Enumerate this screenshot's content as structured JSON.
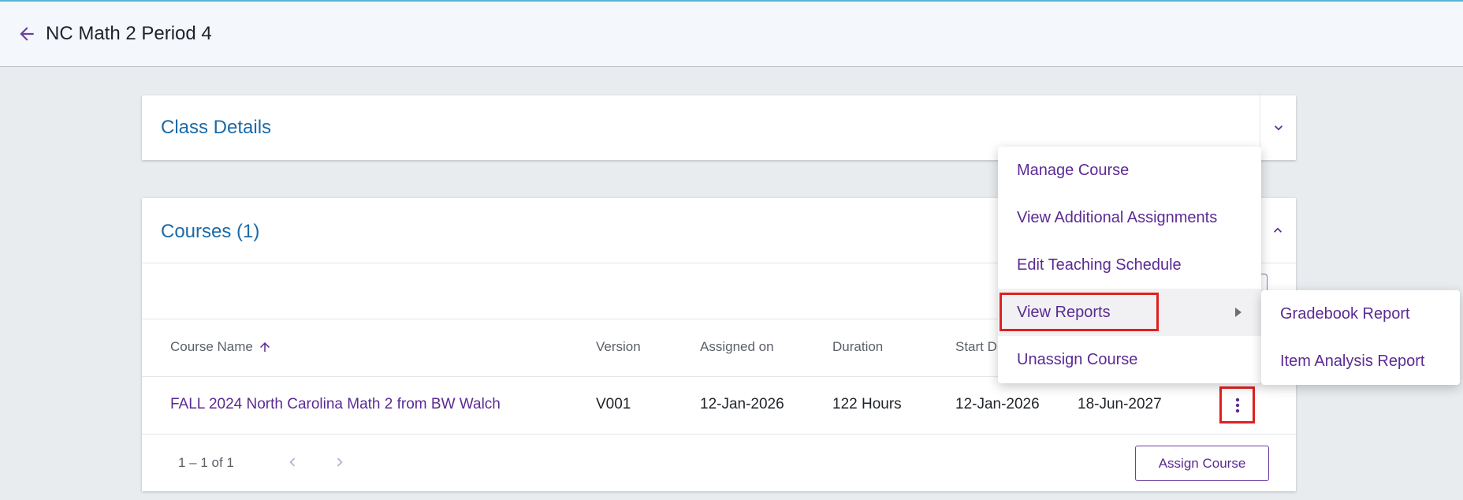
{
  "header": {
    "title": "NC Math 2 Period 4"
  },
  "class_details": {
    "title": "Class Details"
  },
  "courses": {
    "title": "Courses (1)",
    "columns": [
      "Course Name",
      "Version",
      "Assigned on",
      "Duration",
      "Start D",
      ""
    ],
    "row": {
      "course_name": "FALL 2024 North Carolina Math 2 from BW Walch",
      "version": "V001",
      "assigned_on": "12-Jan-2026",
      "duration": "122 Hours",
      "start_date": "12-Jan-2026",
      "end_date": "18-Jun-2027"
    },
    "pager": {
      "range": "1 – 1 of 1"
    },
    "assign_label": "Assign Course"
  },
  "context_menu": {
    "items": [
      "Manage Course",
      "View Additional Assignments",
      "Edit Teaching Schedule",
      "View Reports",
      "Unassign Course"
    ]
  },
  "reports_submenu": {
    "items": [
      "Gradebook Report",
      "Item Analysis Report"
    ]
  },
  "colors": {
    "accent_purple": "#5b2a93",
    "title_blue": "#1a6aa8",
    "highlight_red": "#e02020"
  }
}
